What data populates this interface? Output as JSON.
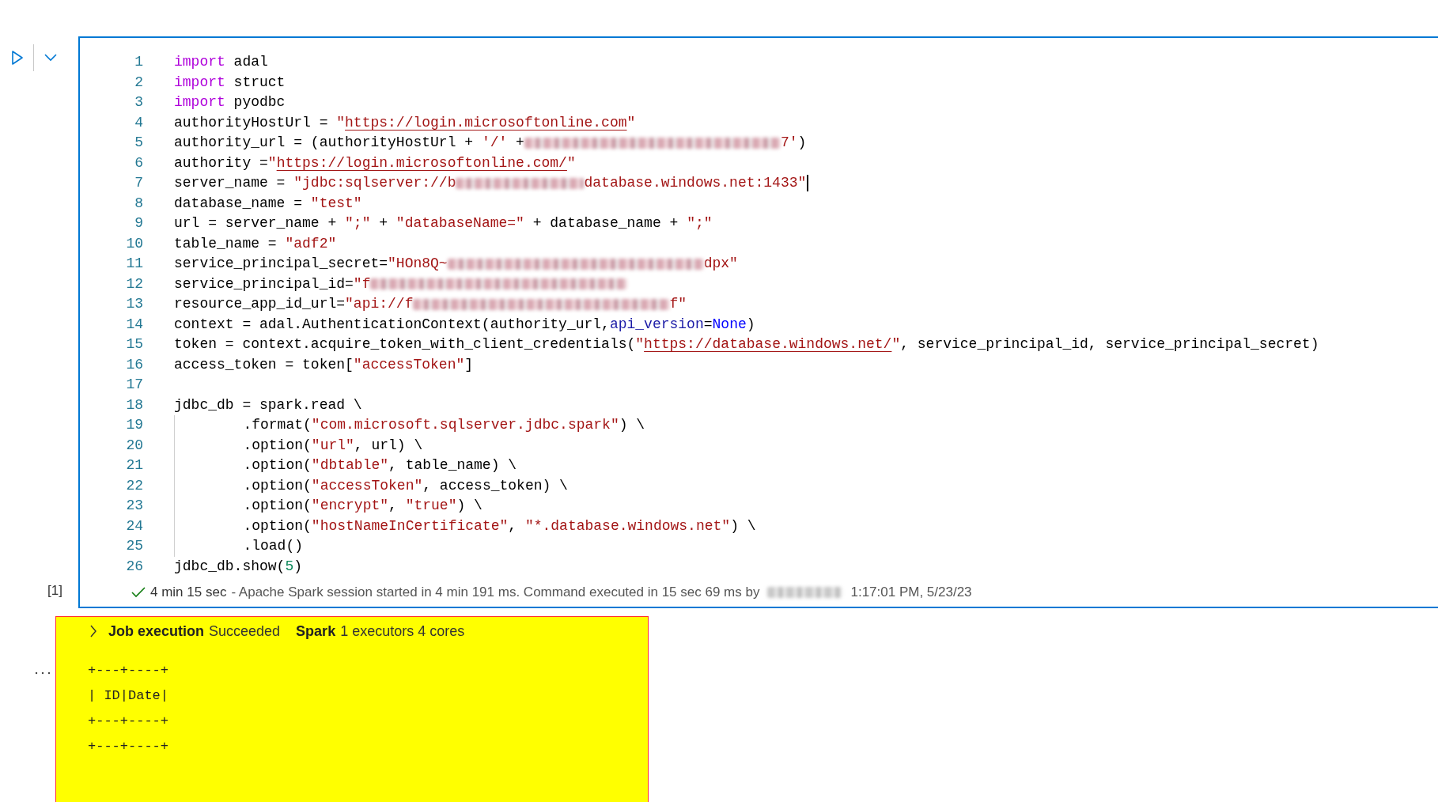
{
  "cell": {
    "execution_count": "[1]",
    "focused": true,
    "lines": [
      {
        "number": "1",
        "tokens": [
          {
            "kind": "keyword",
            "text": "import"
          },
          {
            "kind": "plain",
            "text": " adal"
          }
        ]
      },
      {
        "number": "2",
        "tokens": [
          {
            "kind": "keyword",
            "text": "import"
          },
          {
            "kind": "plain",
            "text": " struct"
          }
        ]
      },
      {
        "number": "3",
        "tokens": [
          {
            "kind": "keyword",
            "text": "import"
          },
          {
            "kind": "plain",
            "text": " pyodbc"
          }
        ]
      },
      {
        "number": "4",
        "tokens": [
          {
            "kind": "plain",
            "text": "authorityHostUrl = "
          },
          {
            "kind": "string",
            "text": "\""
          },
          {
            "kind": "link",
            "text": "https://login.microsoftonline.com"
          },
          {
            "kind": "string",
            "text": "\""
          }
        ]
      },
      {
        "number": "5",
        "tokens": [
          {
            "kind": "plain",
            "text": "authority_url = (authorityHostUrl + "
          },
          {
            "kind": "string",
            "text": "'/'"
          },
          {
            "kind": "plain",
            "text": " +"
          },
          {
            "kind": "redacted"
          },
          {
            "kind": "string",
            "text": "7'"
          },
          {
            "kind": "plain",
            "text": ")"
          }
        ]
      },
      {
        "number": "6",
        "tokens": [
          {
            "kind": "plain",
            "text": "authority ="
          },
          {
            "kind": "string",
            "text": "\""
          },
          {
            "kind": "link",
            "text": "https://login.microsoftonline.com/"
          },
          {
            "kind": "string",
            "text": "\""
          }
        ]
      },
      {
        "number": "7",
        "tokens": [
          {
            "kind": "plain",
            "text": "server_name = "
          },
          {
            "kind": "string",
            "text": "\"jdbc:sqlserver://b"
          },
          {
            "kind": "redacted_short"
          },
          {
            "kind": "string",
            "text": "database.windows.net:1433\""
          },
          {
            "kind": "cursor"
          }
        ]
      },
      {
        "number": "8",
        "tokens": [
          {
            "kind": "plain",
            "text": "database_name = "
          },
          {
            "kind": "string",
            "text": "\"test\""
          }
        ]
      },
      {
        "number": "9",
        "tokens": [
          {
            "kind": "plain",
            "text": "url = server_name + "
          },
          {
            "kind": "string",
            "text": "\";\""
          },
          {
            "kind": "plain",
            "text": " + "
          },
          {
            "kind": "string",
            "text": "\"databaseName=\""
          },
          {
            "kind": "plain",
            "text": " + database_name + "
          },
          {
            "kind": "string",
            "text": "\";\""
          }
        ]
      },
      {
        "number": "10",
        "tokens": [
          {
            "kind": "plain",
            "text": "table_name = "
          },
          {
            "kind": "string",
            "text": "\"adf2\""
          }
        ]
      },
      {
        "number": "11",
        "tokens": [
          {
            "kind": "plain",
            "text": "service_principal_secret="
          },
          {
            "kind": "string",
            "text": "\"HOn8Q~"
          },
          {
            "kind": "redacted"
          },
          {
            "kind": "string",
            "text": "dpx\""
          }
        ]
      },
      {
        "number": "12",
        "tokens": [
          {
            "kind": "plain",
            "text": "service_principal_id="
          },
          {
            "kind": "string",
            "text": "\"f"
          },
          {
            "kind": "redacted"
          }
        ]
      },
      {
        "number": "13",
        "tokens": [
          {
            "kind": "plain",
            "text": "resource_app_id_url="
          },
          {
            "kind": "string",
            "text": "\"api://f"
          },
          {
            "kind": "redacted"
          },
          {
            "kind": "string",
            "text": "f\""
          }
        ]
      },
      {
        "number": "14",
        "tokens": [
          {
            "kind": "plain",
            "text": "context = adal.AuthenticationContext(authority_url,"
          },
          {
            "kind": "param",
            "text": "api_version"
          },
          {
            "kind": "plain",
            "text": "="
          },
          {
            "kind": "builtin",
            "text": "None"
          },
          {
            "kind": "plain",
            "text": ")"
          }
        ]
      },
      {
        "number": "15",
        "tokens": [
          {
            "kind": "plain",
            "text": "token = context.acquire_token_with_client_credentials("
          },
          {
            "kind": "string",
            "text": "\""
          },
          {
            "kind": "link",
            "text": "https://database.windows.net/"
          },
          {
            "kind": "string",
            "text": "\""
          },
          {
            "kind": "plain",
            "text": ", service_principal_id, service_principal_secret)"
          }
        ]
      },
      {
        "number": "16",
        "tokens": [
          {
            "kind": "plain",
            "text": "access_token = token["
          },
          {
            "kind": "string",
            "text": "\"accessToken\""
          },
          {
            "kind": "plain",
            "text": "]"
          }
        ]
      },
      {
        "number": "17"
      },
      {
        "number": "18",
        "tokens": [
          {
            "kind": "plain",
            "text": "jdbc_db = spark.read \\"
          }
        ]
      },
      {
        "number": "19",
        "tokens": [
          {
            "kind": "indent"
          },
          {
            "kind": "plain",
            "text": ".format("
          },
          {
            "kind": "string",
            "text": "\"com.microsoft.sqlserver.jdbc.spark\""
          },
          {
            "kind": "plain",
            "text": ") \\"
          }
        ]
      },
      {
        "number": "20",
        "tokens": [
          {
            "kind": "indent"
          },
          {
            "kind": "plain",
            "text": ".option("
          },
          {
            "kind": "string",
            "text": "\"url\""
          },
          {
            "kind": "plain",
            "text": ", url) \\"
          }
        ]
      },
      {
        "number": "21",
        "tokens": [
          {
            "kind": "indent"
          },
          {
            "kind": "plain",
            "text": ".option("
          },
          {
            "kind": "string",
            "text": "\"dbtable\""
          },
          {
            "kind": "plain",
            "text": ", table_name) \\"
          }
        ]
      },
      {
        "number": "22",
        "tokens": [
          {
            "kind": "indent"
          },
          {
            "kind": "plain",
            "text": ".option("
          },
          {
            "kind": "string",
            "text": "\"accessToken\""
          },
          {
            "kind": "plain",
            "text": ", access_token) \\"
          }
        ]
      },
      {
        "number": "23",
        "tokens": [
          {
            "kind": "indent"
          },
          {
            "kind": "plain",
            "text": ".option("
          },
          {
            "kind": "string",
            "text": "\"encrypt\""
          },
          {
            "kind": "plain",
            "text": ", "
          },
          {
            "kind": "string",
            "text": "\"true\""
          },
          {
            "kind": "plain",
            "text": ") \\"
          }
        ]
      },
      {
        "number": "24",
        "tokens": [
          {
            "kind": "indent"
          },
          {
            "kind": "plain",
            "text": ".option("
          },
          {
            "kind": "string",
            "text": "\"hostNameInCertificate\""
          },
          {
            "kind": "plain",
            "text": ", "
          },
          {
            "kind": "string",
            "text": "\"*.database.windows.net\""
          },
          {
            "kind": "plain",
            "text": ") \\"
          }
        ]
      },
      {
        "number": "25",
        "tokens": [
          {
            "kind": "indent"
          },
          {
            "kind": "plain",
            "text": ".load()"
          }
        ]
      },
      {
        "number": "26",
        "tokens": [
          {
            "kind": "plain",
            "text": "jdbc_db.show("
          },
          {
            "kind": "number",
            "text": "5"
          },
          {
            "kind": "plain",
            "text": ")"
          }
        ]
      }
    ],
    "status": {
      "succeeded": true,
      "duration": "4 min 15 sec",
      "message": "- Apache Spark session started in 4 min 191 ms. Command executed in 15 sec 69 ms by",
      "timestamp": "1:17:01 PM, 5/23/23"
    }
  },
  "output": {
    "job_label": "Job execution",
    "job_status": "Succeeded",
    "spark_label": "Spark",
    "spark_info": "1 executors 4 cores",
    "expanded": false,
    "table_lines": [
      "+---+----+",
      "| ID|Date|",
      "+---+----+",
      "+---+----+"
    ]
  }
}
